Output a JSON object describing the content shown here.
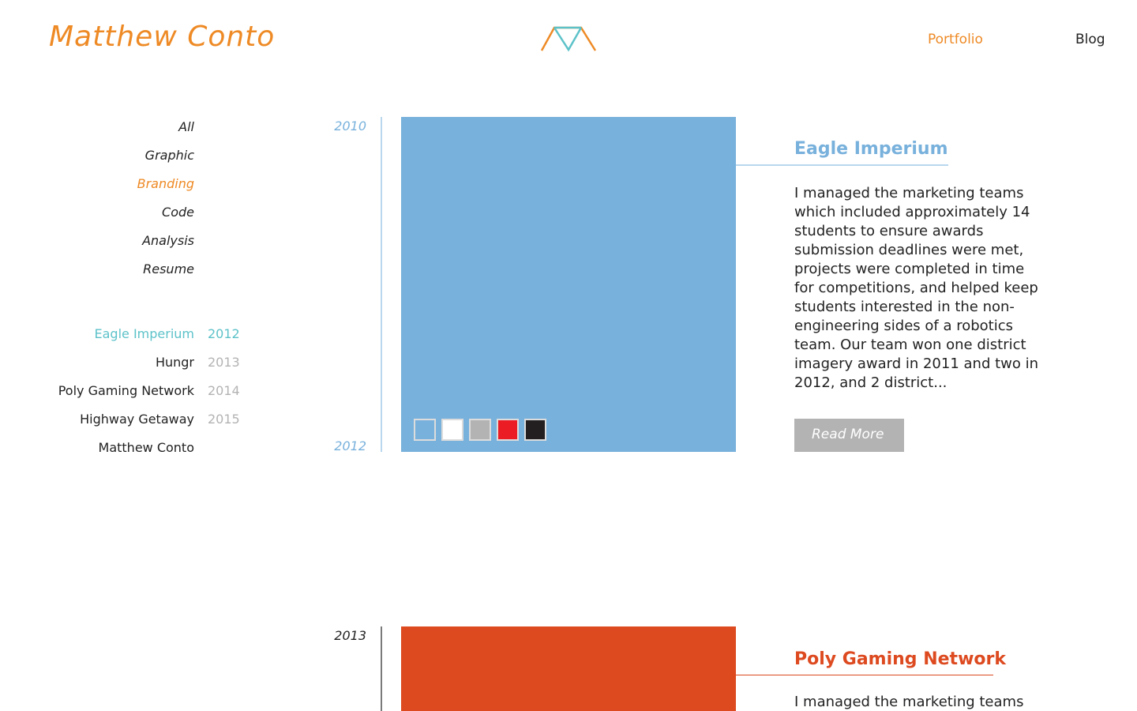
{
  "header": {
    "site_title": "Matthew Conto",
    "nav": [
      {
        "label": "Portfolio",
        "active": true
      },
      {
        "label": "Blog",
        "active": false
      }
    ]
  },
  "categories": [
    {
      "label": "All",
      "active": false
    },
    {
      "label": "Graphic",
      "active": false
    },
    {
      "label": "Branding",
      "active": true
    },
    {
      "label": "Code",
      "active": false
    },
    {
      "label": "Analysis",
      "active": false
    },
    {
      "label": "Resume",
      "active": false
    }
  ],
  "projects": [
    {
      "name": "Eagle Imperium",
      "year": "2012",
      "active": true
    },
    {
      "name": "Hungr",
      "year": "2013",
      "active": false
    },
    {
      "name": "Poly Gaming Network",
      "year": "2014",
      "active": false
    },
    {
      "name": "Highway Getaway",
      "year": "2015",
      "active": false
    },
    {
      "name": "Matthew Conto",
      "year": "",
      "active": false
    }
  ],
  "sections": [
    {
      "title": "Eagle Imperium",
      "start_year": "2010",
      "end_year": "2012",
      "description": "I managed the marketing teams which included approximately 14 students to ensure awards submission deadlines were met, projects were completed in time for competitions, and helped keep students interested in the non-engineering sides of a robotics team. Our team won one district imagery award in 2011 and two in 2012, and 2 district...",
      "button_label": "Read More",
      "palette": [
        "#78b1dc",
        "#ffffff",
        "#b3b3b3",
        "#ec1c24",
        "#231f20"
      ]
    },
    {
      "title": "Poly Gaming Network",
      "start_year": "2013",
      "description": "I managed the marketing teams"
    }
  ],
  "colors": {
    "brand_orange": "#ee8a25",
    "eagle_blue": "#78b1dc",
    "teal": "#5cc2c9",
    "poly_red": "#dd4a20",
    "text_dark": "#222222",
    "text_muted": "#b3b3b3"
  },
  "icons": {
    "logo": "mc-monogram-logo-icon"
  }
}
